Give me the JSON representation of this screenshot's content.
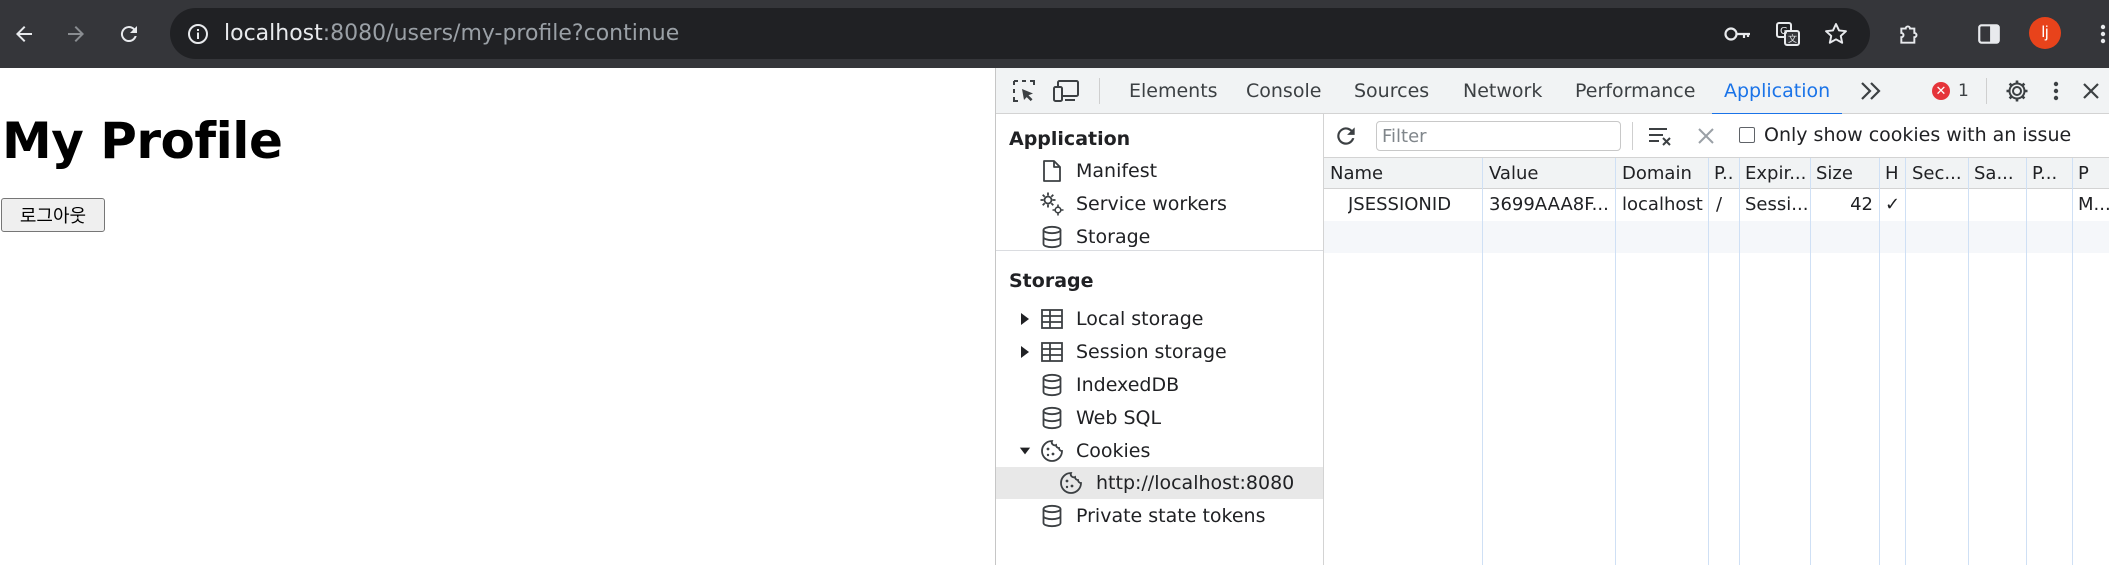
{
  "browser": {
    "url_host": "localhost",
    "url_rest": ":8080/users/my-profile?continue",
    "profile_initial": "lj"
  },
  "page": {
    "title": "My Profile",
    "logout_label": "로그아웃"
  },
  "devtools": {
    "tabs": [
      {
        "label": "Elements"
      },
      {
        "label": "Console"
      },
      {
        "label": "Sources"
      },
      {
        "label": "Network"
      },
      {
        "label": "Performance"
      },
      {
        "label": "Application"
      }
    ],
    "active_tab": "Application",
    "error_count": "1",
    "sidebar": {
      "application_header": "Application",
      "application_items": [
        {
          "label": "Manifest",
          "icon": "file-icon"
        },
        {
          "label": "Service workers",
          "icon": "gears-icon"
        },
        {
          "label": "Storage",
          "icon": "database-icon"
        }
      ],
      "storage_header": "Storage",
      "storage_items": [
        {
          "label": "Local storage",
          "icon": "table-icon"
        },
        {
          "label": "Session storage",
          "icon": "table-icon"
        },
        {
          "label": "IndexedDB",
          "icon": "database-icon"
        },
        {
          "label": "Web SQL",
          "icon": "database-icon"
        },
        {
          "label": "Cookies",
          "icon": "cookie-icon"
        },
        {
          "label": "http://localhost:8080",
          "icon": "cookie-icon"
        },
        {
          "label": "Private state tokens",
          "icon": "database-icon"
        }
      ]
    },
    "filter": {
      "placeholder": "Filter",
      "only_issue_label": "Only show cookies with an issue"
    },
    "cookie_table": {
      "headers": [
        "Name",
        "Value",
        "Domain",
        "P..",
        "Expir...",
        "Size",
        "H",
        "Sec...",
        "Sa...",
        "P...",
        "P"
      ],
      "rows": [
        {
          "name": "JSESSIONID",
          "value": "3699AAA8F...",
          "domain": "localhost",
          "path": "/",
          "expires": "Sessi...",
          "size": "42",
          "httponly": "✓",
          "secure": "",
          "samesite": "",
          "partition": "",
          "priority": "M..."
        }
      ]
    }
  }
}
